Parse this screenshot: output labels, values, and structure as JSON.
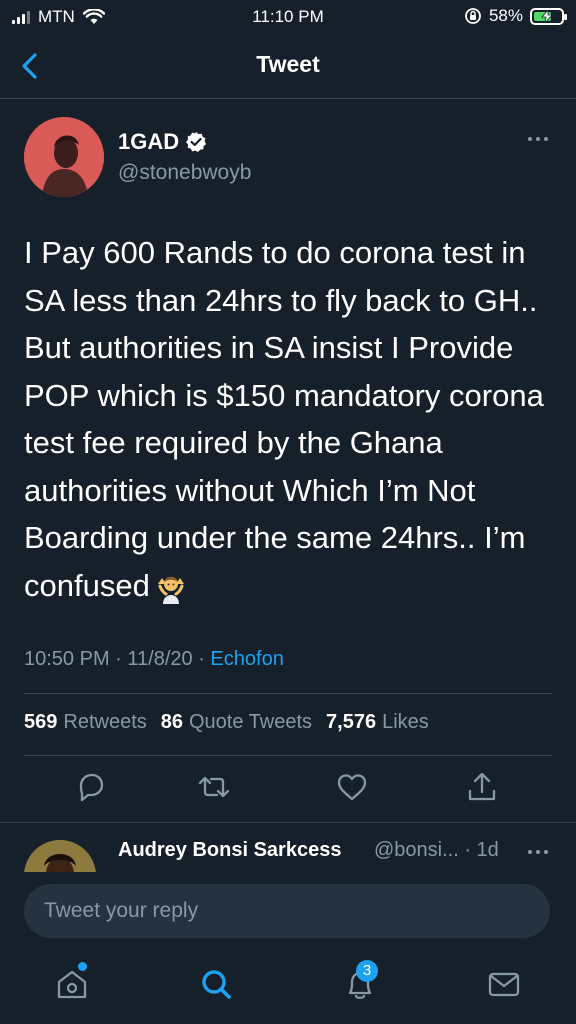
{
  "status_bar": {
    "carrier": "MTN",
    "time": "11:10 PM",
    "battery": "58%",
    "battery_level": 0.58,
    "icons": [
      "signal-icon",
      "wifi-icon",
      "orientation-lock-icon",
      "battery-charging-icon"
    ]
  },
  "nav": {
    "title": "Tweet",
    "back_icon": "chevron-left-icon"
  },
  "tweet": {
    "author_name": "1GAD",
    "verified": true,
    "handle": "@stonebwoyb",
    "text": "I Pay 600 Rands to do corona test in SA less than 24hrs to fly back to GH.. But authorities in SA insist I Provide POP which is $150 mandatory corona test fee required by the Ghana authorities without Which I’m Not Boarding under the same 24hrs.. I’m confused",
    "emoji": "person-shrugging-emoji",
    "time": "10:50 PM",
    "sep1": " · ",
    "date": "11/8/20",
    "sep2": " · ",
    "source": "Echofon",
    "stats": {
      "retweets_count": "569",
      "retweets_label": "Retweets",
      "quotes_count": "86",
      "quotes_label": "Quote Tweets",
      "likes_count": "7,576",
      "likes_label": "Likes"
    },
    "actions": [
      "reply-icon",
      "retweet-icon",
      "like-icon",
      "share-icon"
    ]
  },
  "reply": {
    "name": "Audrey Bonsi Sarkcess",
    "handle_time": "@bonsi... · 1d"
  },
  "composer": {
    "placeholder": "Tweet your reply"
  },
  "tabs": {
    "items": [
      "home-icon",
      "search-icon",
      "notifications-icon",
      "messages-icon"
    ],
    "notifications_badge": "3",
    "active_tab": "search"
  },
  "colors": {
    "background": "#15202b",
    "accent": "#1da1f2",
    "secondary_text": "#8899a6",
    "divider": "#38444d",
    "battery": "#4cd964"
  }
}
